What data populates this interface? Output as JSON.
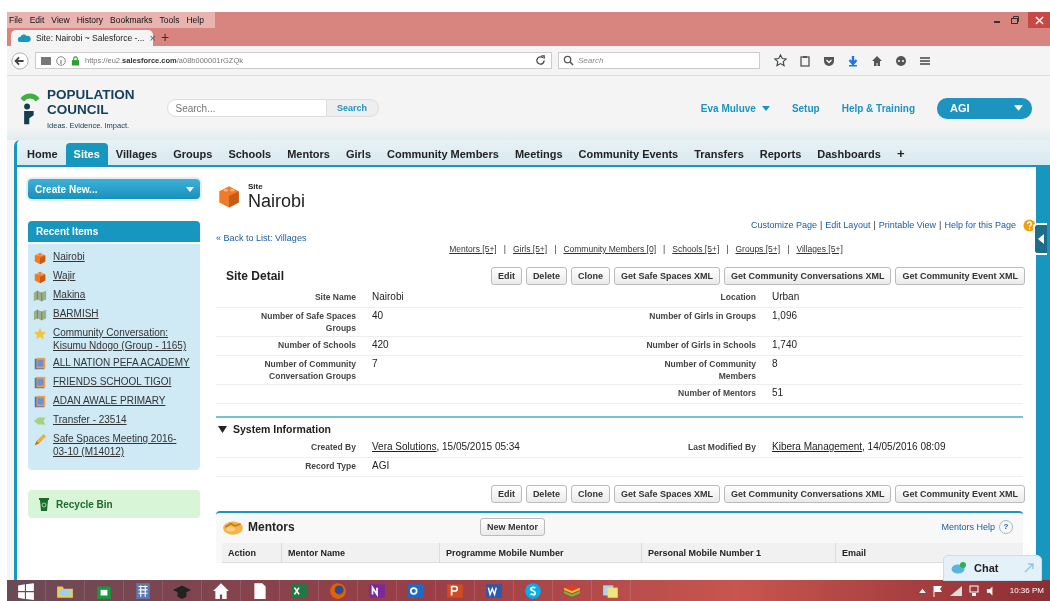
{
  "browser": {
    "menu": [
      "File",
      "Edit",
      "View",
      "History",
      "Bookmarks",
      "Tools",
      "Help"
    ],
    "tab_title": "Site: Nairobi ~ Salesforce -...",
    "tab_close": "×",
    "new_tab": "+",
    "url": "https://eu2.**salesforce.com**/a08b000001rGZQk",
    "search_placeholder": "Search"
  },
  "header": {
    "logo_line1": "POPULATION",
    "logo_line2": "COUNCIL",
    "tagline": "Ideas. Evidence. Impact.",
    "search_placeholder": "Search...",
    "search_button": "Search",
    "user": "Eva Muluve",
    "links": [
      "Setup",
      "Help & Training"
    ],
    "app": "AGI"
  },
  "tabs": [
    {
      "label": "Home",
      "selected": false
    },
    {
      "label": "Sites",
      "selected": true
    },
    {
      "label": "Villages",
      "selected": false
    },
    {
      "label": "Groups",
      "selected": false
    },
    {
      "label": "Schools",
      "selected": false
    },
    {
      "label": "Mentors",
      "selected": false
    },
    {
      "label": "Girls",
      "selected": false
    },
    {
      "label": "Community Members",
      "selected": false
    },
    {
      "label": "Meetings",
      "selected": false
    },
    {
      "label": "Community Events",
      "selected": false
    },
    {
      "label": "Transfers",
      "selected": false
    },
    {
      "label": "Reports",
      "selected": false
    },
    {
      "label": "Dashboards",
      "selected": false
    }
  ],
  "add_tab": "+",
  "sidebar": {
    "create_new": "Create New...",
    "recent_title": "Recent Items",
    "recent_items": [
      {
        "label": "Nairobi",
        "kind": "site"
      },
      {
        "label": "Wajir",
        "kind": "site"
      },
      {
        "label": "Makina",
        "kind": "village"
      },
      {
        "label": "BARMISH",
        "kind": "village"
      },
      {
        "label": "Community Conversation: Kisumu Ndogo (Group - 1165)",
        "kind": "group"
      },
      {
        "label": "ALL NATION PEFA ACADEMY",
        "kind": "school"
      },
      {
        "label": "FRIENDS SCHOOL TIGOI",
        "kind": "school"
      },
      {
        "label": "ADAN AWALE PRIMARY",
        "kind": "school"
      },
      {
        "label": "Transfer - 23514",
        "kind": "transfer"
      },
      {
        "label": "Safe Spaces Meeting 2016-03-10 (M14012)",
        "kind": "meeting"
      }
    ],
    "recycle_bin": "Recycle Bin"
  },
  "record": {
    "type_label": "Site",
    "separator": "|",
    "name": "Nairobi",
    "back_link": "« Back to List: Villages",
    "page_links": [
      "Customize Page",
      "Edit Layout",
      "Printable View",
      "Help for this Page"
    ],
    "related": [
      {
        "label": "Mentors",
        "count": "[5+]"
      },
      {
        "label": "Girls",
        "count": "[5+]"
      },
      {
        "label": "Community Members",
        "count": "[0]"
      },
      {
        "label": "Schools",
        "count": "[5+]"
      },
      {
        "label": "Groups",
        "count": "[5+]"
      },
      {
        "label": "Villages",
        "count": "[5+]"
      }
    ]
  },
  "detail": {
    "title": "Site Detail",
    "buttons": [
      "Edit",
      "Delete",
      "Clone",
      "Get Safe Spaces XML",
      "Get Community Conversations XML",
      "Get Community Event XML"
    ],
    "rows": [
      {
        "left": {
          "label": "Site Name",
          "value": "Nairobi"
        },
        "right": {
          "label": "Location",
          "value": "Urban"
        }
      },
      {
        "left": {
          "label": "Number of Safe Spaces Groups",
          "value": "40"
        },
        "right": {
          "label": "Number of Girls in Groups",
          "value": "1,096"
        }
      },
      {
        "left": {
          "label": "Number of Schools",
          "value": "420"
        },
        "right": {
          "label": "Number of Girls in Schools",
          "value": "1,740"
        }
      },
      {
        "left": {
          "label": "Number of Community Conversation Groups",
          "value": "7"
        },
        "right": {
          "label": "Number of Community Members",
          "value": "8"
        }
      },
      {
        "right": {
          "label": "Number of Mentors",
          "value": "51"
        }
      }
    ],
    "system": {
      "title": "System Information",
      "expanded": true,
      "rows": [
        {
          "left": {
            "label": "Created By",
            "link": "Vera Solutions",
            "value": ", 15/05/2015 05:34"
          },
          "right": {
            "label": "Last Modified By",
            "link": "Kibera Management",
            "value": ", 14/05/2016 08:09"
          }
        },
        {
          "left": {
            "label": "Record Type",
            "value": "AGI"
          }
        }
      ]
    },
    "bottom_buttons": [
      "Edit",
      "Delete",
      "Clone",
      "Get Safe Spaces XML",
      "Get Community Conversations XML",
      "Get Community Event XML"
    ]
  },
  "mentors": {
    "title": "Mentors",
    "button": "New Mentor",
    "help": "Mentors Help",
    "help_icon": "?",
    "columns": [
      "Action",
      "Mentor Name",
      "Programme Mobile Number",
      "Personal Mobile Number 1",
      "Email"
    ]
  },
  "chat": "Chat",
  "taskbar": {
    "time": "10:36 PM"
  }
}
